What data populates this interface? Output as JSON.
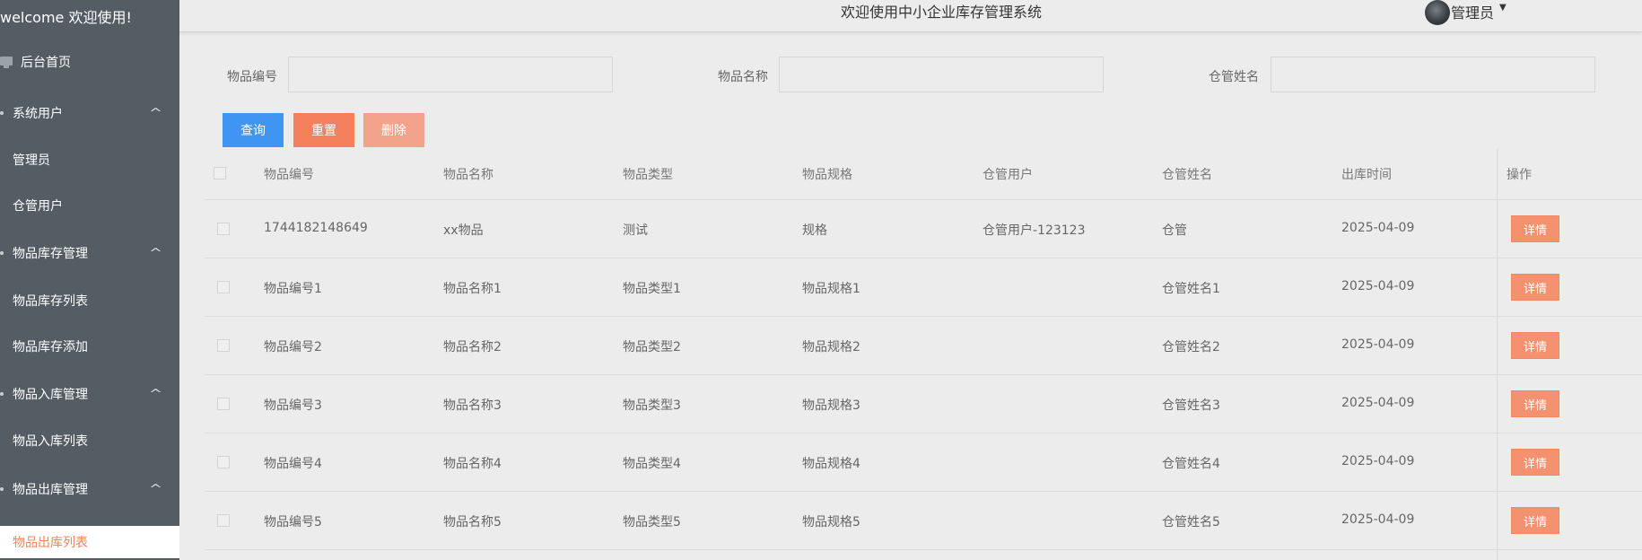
{
  "sidebar": {
    "welcome": "welcome 欢迎使用!",
    "home": "后台首页",
    "groups": [
      {
        "label": "系统用户",
        "items": [
          "管理员",
          "仓管用户"
        ]
      },
      {
        "label": "物品库存管理",
        "items": [
          "物品库存列表",
          "物品库存添加"
        ]
      },
      {
        "label": "物品入库管理",
        "items": [
          "物品入库列表"
        ]
      },
      {
        "label": "物品出库管理",
        "items": [
          "物品出库列表"
        ]
      }
    ],
    "active_item": "物品出库列表"
  },
  "header": {
    "title": "欢迎使用中小企业库存管理系统",
    "user": "管理员"
  },
  "search": {
    "code_label": "物品编号",
    "code_value": "",
    "name_label": "物品名称",
    "name_value": "",
    "keeper_label": "仓管姓名",
    "keeper_value": "",
    "query_label": "查询",
    "reset_label": "重置",
    "delete_label": "删除"
  },
  "table": {
    "columns": [
      "物品编号",
      "物品名称",
      "物品类型",
      "物品规格",
      "仓管用户",
      "仓管姓名",
      "出库时间",
      "操作"
    ],
    "rows": [
      [
        "1744182148649",
        "xx物品",
        "测试",
        "规格",
        "仓管用户-123123",
        "仓管",
        "2025-04-09"
      ],
      [
        "物品编号1",
        "物品名称1",
        "物品类型1",
        "物品规格1",
        "",
        "仓管姓名1",
        "2025-04-09"
      ],
      [
        "物品编号2",
        "物品名称2",
        "物品类型2",
        "物品规格2",
        "",
        "仓管姓名2",
        "2025-04-09"
      ],
      [
        "物品编号3",
        "物品名称3",
        "物品类型3",
        "物品规格3",
        "",
        "仓管姓名3",
        "2025-04-09"
      ],
      [
        "物品编号4",
        "物品名称4",
        "物品类型4",
        "物品规格4",
        "",
        "仓管姓名4",
        "2025-04-09"
      ],
      [
        "物品编号5",
        "物品名称5",
        "物品类型5",
        "物品规格5",
        "",
        "仓管姓名5",
        "2025-04-09"
      ]
    ],
    "detail_label": "详情"
  },
  "colors": {
    "sidebar_bg": "#545c64",
    "active_text": "#f0845f",
    "query_btn": "#3f95f1",
    "reset_btn": "#f5805e",
    "delete_btn": "#f3a38c",
    "detail_btn": "#f4916f"
  }
}
